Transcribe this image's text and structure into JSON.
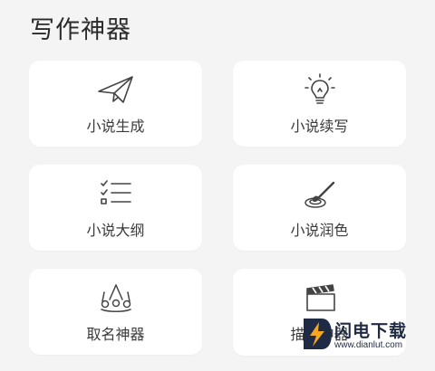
{
  "page": {
    "title": "写作神器"
  },
  "tools": [
    {
      "label": "小说生成",
      "icon": "paper-plane-icon"
    },
    {
      "label": "小说续写",
      "icon": "lightbulb-icon"
    },
    {
      "label": "小说大纲",
      "icon": "checklist-icon"
    },
    {
      "label": "小说润色",
      "icon": "brush-palette-icon"
    },
    {
      "label": "取名神器",
      "icon": "crown-icon"
    },
    {
      "label": "描述神器",
      "icon": "clapperboard-icon"
    }
  ],
  "watermark": {
    "name": "闪电下载",
    "url": "www.dianlut.com"
  },
  "colors": {
    "background": "#f4f4f4",
    "card": "#ffffff",
    "text": "#333333",
    "watermark": "#1f2a44",
    "accent": "#f5a623"
  }
}
